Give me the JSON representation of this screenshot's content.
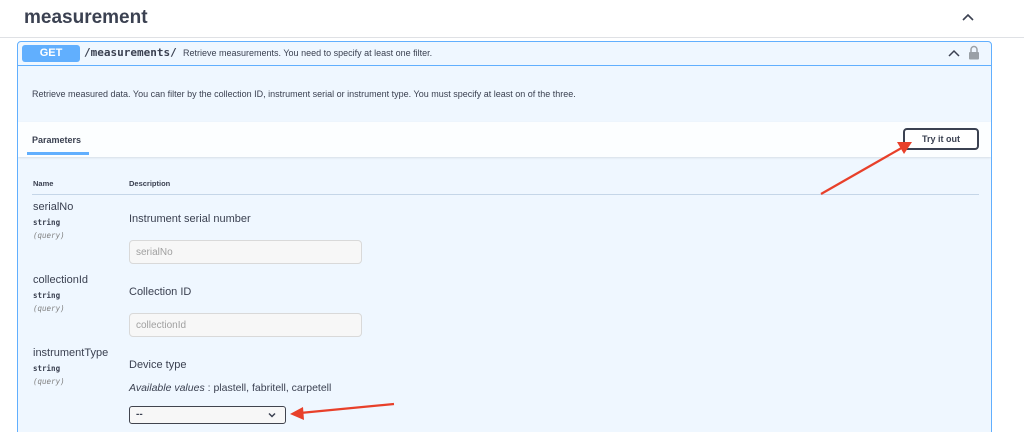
{
  "tag": {
    "title": "measurement",
    "collapse_icon": "chevron-up-icon"
  },
  "operation": {
    "method": "GET",
    "path": "/measurements/",
    "summary": "Retrieve measurements. You need to specify at least one filter.",
    "description": "Retrieve measured data. You can filter by the collection ID, instrument serial or instrument type. You must specify at least on of the three.",
    "lock_icon": "lock-icon"
  },
  "parameters": {
    "tab_label": "Parameters",
    "try_label": "Try it out",
    "head_name": "Name",
    "head_description": "Description",
    "items": [
      {
        "name": "serialNo",
        "type": "string",
        "in": "(query)",
        "description": "Instrument serial number",
        "placeholder": "serialNo"
      },
      {
        "name": "collectionId",
        "type": "string",
        "in": "(query)",
        "description": "Collection ID",
        "placeholder": "collectionId"
      },
      {
        "name": "instrumentType",
        "type": "string",
        "in": "(query)",
        "description": "Device type",
        "available_label": "Available values",
        "available_values": " : plastell, fabritell, carpetell",
        "selected": "--"
      }
    ]
  },
  "colors": {
    "get": "#61affe",
    "text": "#3b4151",
    "annotation_arrow": "#e8402a"
  }
}
